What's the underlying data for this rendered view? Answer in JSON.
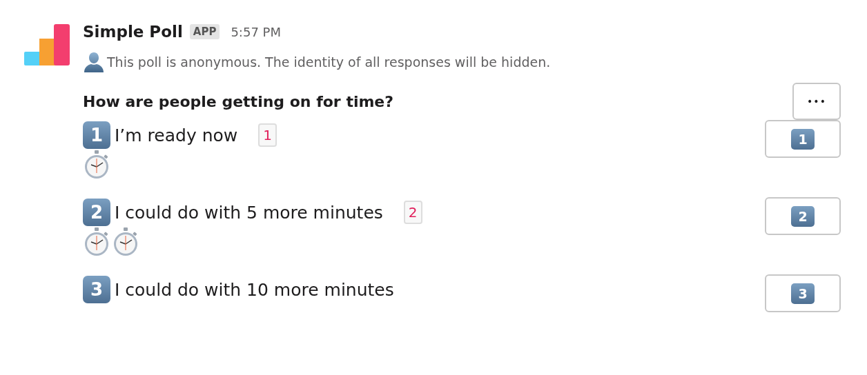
{
  "message": {
    "sender": "Simple Poll",
    "badge": "APP",
    "time": "5:57 PM",
    "notice": "This poll is anonymous. The identity of all responses will be hidden."
  },
  "poll": {
    "question": "How are people getting on for time?",
    "menu_button": "•••",
    "options": [
      {
        "number": "1",
        "label": "I’m ready now",
        "count": "1",
        "responses": [
          {
            "kind": "anonymous"
          }
        ],
        "button": "1"
      },
      {
        "number": "2",
        "label": "I could do with 5 more minutes",
        "count": "2",
        "responses": [
          {
            "kind": "anonymous"
          },
          {
            "kind": "anonymous"
          }
        ],
        "button": "2"
      },
      {
        "number": "3",
        "label": "I could do with 10 more minutes",
        "button": "3"
      }
    ]
  }
}
